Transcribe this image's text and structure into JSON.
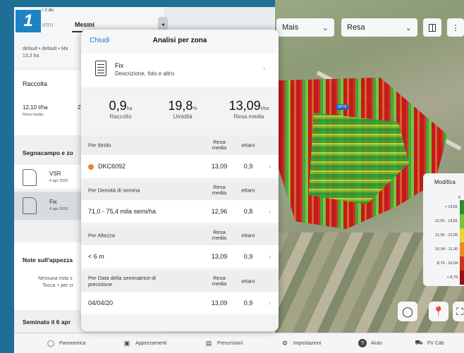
{
  "step": "1",
  "header": {
    "date": "r 2 dic",
    "tab_left": "etro",
    "tab_right": "Mesini",
    "field_info": "default • default • Ma",
    "area": "13,3 ha"
  },
  "topbar": {
    "crop": "Mais",
    "layer": "Resa"
  },
  "left_panel": {
    "raccolta_title": "Raccolta",
    "raccolta_value": "12,10 t/ha",
    "raccolta_value_label": "Resa media",
    "raccolta_extra": "2",
    "segnacampo_title": "Segnacampo e zo",
    "items": [
      {
        "name": "VSR",
        "date": "4 apr 2020"
      },
      {
        "name": "Fix",
        "date": "4 apr 2020"
      }
    ],
    "note_title": "Note sull'appezza",
    "note_empty": "Nessuna nota s",
    "note_hint": "Tocca + per cr",
    "seminato": "Seminato il 6 apr"
  },
  "modal": {
    "close": "Chiudi",
    "title": "Analisi per zona",
    "fix_title": "Fix",
    "fix_desc": "Descrizione, foto e altro",
    "stats": [
      {
        "value": "0,9",
        "unit": "ha",
        "label": "Raccolto"
      },
      {
        "value": "19,8",
        "unit": "%",
        "label": "Umidità"
      },
      {
        "value": "13,09",
        "unit": "t/ha",
        "label": "Resa media"
      }
    ],
    "col_resa": "Resa media",
    "col_ettaro": "ettaro",
    "groups": [
      {
        "title": "Per Ibrido",
        "row": {
          "label": "DKC6092",
          "resa": "13,09",
          "ettaro": "0,9"
        }
      },
      {
        "title": "Per Densità di semina",
        "row": {
          "label": "71,0 - 75,4 mila semi/ha",
          "resa": "12,96",
          "ettaro": "0,8"
        }
      },
      {
        "title": "Per Altezza",
        "row": {
          "label": "< 6 m",
          "resa": "13,09",
          "ettaro": "0,9"
        }
      },
      {
        "title": "Per Data della seminatrice di precisione",
        "row": {
          "label": "04/04/20",
          "resa": "13,09",
          "ettaro": "0,9"
        }
      }
    ]
  },
  "legend": {
    "title": "Modifica",
    "unit": "t/",
    "ranges": [
      {
        "label": "> 13,81",
        "color": "#2e8b2e"
      },
      {
        "label": "12,55 - 13,81",
        "color": "#7cc23b"
      },
      {
        "label": "11,30 - 12,55",
        "color": "#e3d82b"
      },
      {
        "label": "10,04 - 11,30",
        "color": "#ef8a23"
      },
      {
        "label": "8,79 - 10,04",
        "color": "#d4301f"
      },
      {
        "label": "< 8,79",
        "color": "#9a0f14"
      }
    ]
  },
  "road_badge": "SP79",
  "bottom_nav": [
    {
      "label": "Panoramica",
      "icon": "circle-icon"
    },
    {
      "label": "Appezzamenti",
      "icon": "field-icon"
    },
    {
      "label": "Prescrizioni",
      "icon": "prescription-icon"
    },
    {
      "label": "Impostazioni",
      "icon": "gear-icon"
    },
    {
      "label": "Aiuto",
      "icon": "help-icon"
    },
    {
      "label": "FV Cab",
      "icon": "tractor-icon"
    }
  ],
  "colors": {
    "accent": "#1c75d0",
    "badge": "#1d84c4",
    "dot": "#e8843a"
  }
}
